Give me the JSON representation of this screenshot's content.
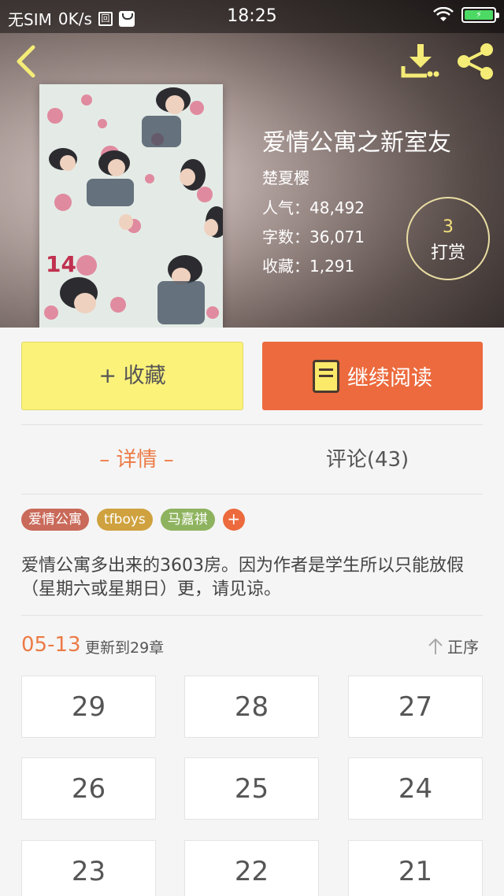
{
  "status_bar": {
    "carrier": "无SIM",
    "speed": "0K/s",
    "sim_glyph": "回",
    "time": "18:25",
    "battery_glyph": "⚡"
  },
  "book": {
    "title": "爱情公寓之新室友",
    "author": "楚夏樱",
    "popularity": "人气：48,492",
    "word_count": "字数：36,071",
    "favorites": "收藏：1,291"
  },
  "tip": {
    "count": "3",
    "label": "打赏"
  },
  "actions": {
    "collect_label": "+ 收藏",
    "read_label": "继续阅读"
  },
  "tabs": {
    "detail": "– 详情 –",
    "comments": "评论(43)"
  },
  "tags": [
    {
      "label": "爱情公寓",
      "color": "#c96a5a"
    },
    {
      "label": "tfboys",
      "color": "#cfa23f"
    },
    {
      "label": "马嘉祺",
      "color": "#8eb35e"
    }
  ],
  "tag_add_label": "+",
  "description": "爱情公寓多出来的3603房。因为作者是学生所以只能放假（星期六或星期日）更，请见谅。",
  "update": {
    "date": "05-13",
    "text": "更新到29章",
    "sort_label": "正序"
  },
  "chapters": [
    "29",
    "28",
    "27",
    "26",
    "25",
    "24",
    "23",
    "22",
    "21"
  ],
  "colors": {
    "accent": "#ec6a3d",
    "collect_bg": "#fbf27a",
    "icon_yellow": "#f5ec77"
  }
}
